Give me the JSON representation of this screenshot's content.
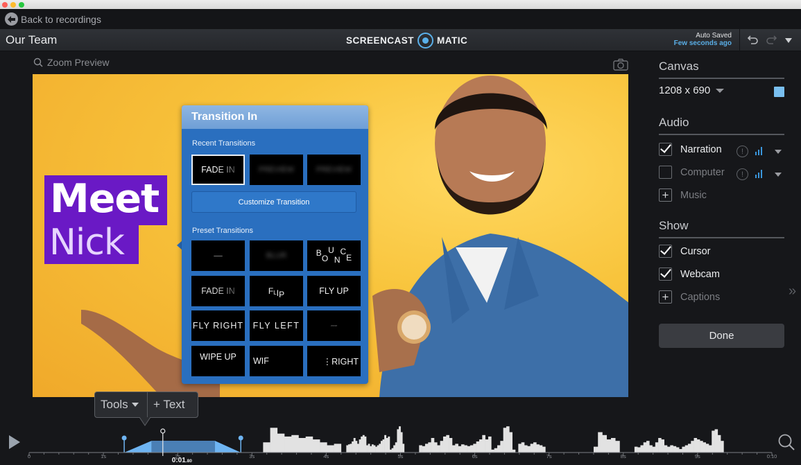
{
  "window": {
    "back_label": "Back to recordings"
  },
  "header": {
    "project_title": "Our Team",
    "logo_left": "SCREENCAST",
    "logo_right": "MATIC",
    "autosave_status": "Auto Saved",
    "autosave_time": "Few seconds ago",
    "undo_icon": "undo-icon",
    "redo_icon": "redo-icon",
    "menu_icon": "caret-down-icon"
  },
  "preview": {
    "zoom_label": "Zoom Preview",
    "overlay_line1": "Meet",
    "overlay_line2": "Nick",
    "accent_color": "#6a19c5"
  },
  "transition_panel": {
    "title": "Transition In",
    "recent_label": "Recent Transitions",
    "recent": [
      {
        "label": "FADE IN",
        "selected": true
      },
      {
        "label": "PREVIEW",
        "blurred": true
      },
      {
        "label": "PREVIEW",
        "blurred": true
      }
    ],
    "customize_label": "Customize Transition",
    "preset_label": "Preset Transitions",
    "presets": [
      {
        "label": "—"
      },
      {
        "label": "BLUR",
        "blurred": true
      },
      {
        "label": "BOUNCE"
      },
      {
        "label": "FADE IN"
      },
      {
        "label": "FLIP"
      },
      {
        "label": "FLY UP"
      },
      {
        "label": "FLY RIGHT"
      },
      {
        "label": "FLY LEFT"
      },
      {
        "label": "ZOOM"
      },
      {
        "label": "WIPE UP"
      },
      {
        "label": "WIF"
      },
      {
        "label": "RIGHT"
      }
    ]
  },
  "sidebar": {
    "canvas_heading": "Canvas",
    "resolution": "1208 x 690",
    "canvas_color": "#79bff0",
    "audio_heading": "Audio",
    "audio": [
      {
        "label": "Narration",
        "checked": true,
        "enabled": true
      },
      {
        "label": "Computer",
        "checked": false,
        "enabled": false
      }
    ],
    "music_label": "Music",
    "show_heading": "Show",
    "show": [
      {
        "label": "Cursor",
        "checked": true
      },
      {
        "label": "Webcam",
        "checked": true
      }
    ],
    "captions_label": "Captions",
    "done_label": "Done"
  },
  "tools": {
    "tools_label": "Tools",
    "text_label": "+ Text"
  },
  "timeline": {
    "current_time_main": "0:01",
    "current_time_frac": ".80",
    "current_time_sec": 1.8,
    "duration_sec": 10,
    "tick_labels": [
      "0",
      "1s",
      "2s",
      "3s",
      "4s",
      "5s",
      "6s",
      "7s",
      "8s",
      "9s",
      "0:10"
    ],
    "transition_start_sec": 1.28,
    "transition_full_start_sec": 1.65,
    "transition_full_end_sec": 2.5,
    "transition_end_sec": 2.85,
    "waveform_segments": [
      {
        "start": 3.15,
        "end": 4.2,
        "levels": [
          0.35,
          0.85,
          0.65,
          0.55,
          0.6,
          0.5,
          0.55,
          0.45,
          0.35,
          0.25,
          0.3
        ]
      },
      {
        "start": 4.27,
        "end": 5.05,
        "levels": [
          0.25,
          0.28,
          0.3,
          0.38,
          0.5,
          0.4,
          0.3,
          0.45,
          0.55,
          0.6,
          0.55,
          0.25,
          0.3,
          0.22,
          0.28,
          0.25,
          0.2,
          0.25,
          0.3,
          0.4,
          0.45,
          0.6,
          0.5,
          0.55,
          0.1,
          0.15,
          0.25,
          0.35,
          0.8,
          0.9,
          0.7,
          0.3
        ]
      },
      {
        "start": 5.25,
        "end": 6.95,
        "levels": [
          0.25,
          0.22,
          0.3,
          0.35,
          0.5,
          0.35,
          0.25,
          0.4,
          0.55,
          0.6,
          0.5,
          0.25,
          0.3,
          0.22,
          0.28,
          0.25,
          0.22,
          0.25,
          0.3,
          0.38,
          0.45,
          0.6,
          0.45,
          0.55,
          0.1,
          0.15,
          0.25,
          0.4,
          0.85,
          0.9,
          0.7,
          0.1,
          0.0,
          0.3,
          0.35,
          0.25,
          0.22,
          0.3,
          0.35,
          0.28,
          0.25,
          0.2
        ]
      },
      {
        "start": 7.6,
        "end": 7.95,
        "levels": [
          0.2,
          0.7,
          0.6,
          0.45,
          0.5,
          0.4
        ]
      },
      {
        "start": 8.15,
        "end": 9.35,
        "levels": [
          0.2,
          0.18,
          0.25,
          0.35,
          0.4,
          0.25,
          0.2,
          0.35,
          0.5,
          0.45,
          0.25,
          0.2,
          0.25,
          0.22,
          0.18,
          0.12,
          0.2,
          0.25,
          0.3,
          0.4,
          0.5,
          0.45,
          0.4,
          0.35,
          0.3,
          0.25,
          0.75,
          0.8,
          0.6,
          0.4
        ]
      }
    ]
  }
}
